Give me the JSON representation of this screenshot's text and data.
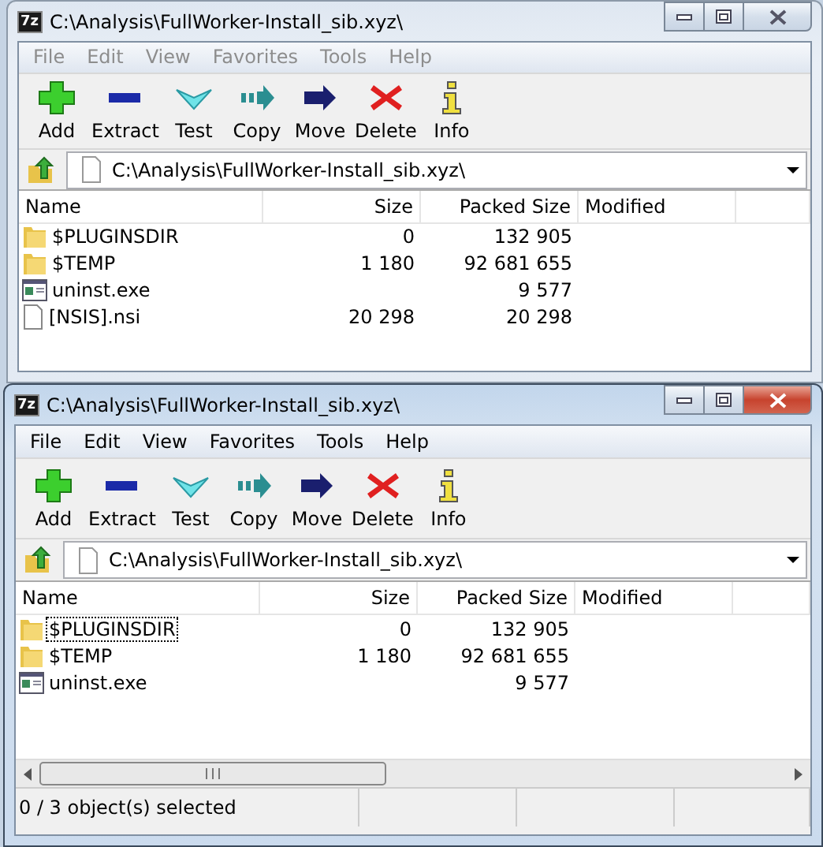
{
  "windows": [
    {
      "icon_label": "7z",
      "title": "C:\\Analysis\\FullWorker-Install_sib.xyz\\",
      "active": false,
      "menu": [
        "File",
        "Edit",
        "View",
        "Favorites",
        "Tools",
        "Help"
      ],
      "toolbar": [
        {
          "kind": "add",
          "label": "Add"
        },
        {
          "kind": "extract",
          "label": "Extract"
        },
        {
          "kind": "test",
          "label": "Test"
        },
        {
          "kind": "copy",
          "label": "Copy"
        },
        {
          "kind": "move",
          "label": "Move"
        },
        {
          "kind": "delete",
          "label": "Delete"
        },
        {
          "kind": "info",
          "label": "Info"
        }
      ],
      "address": "C:\\Analysis\\FullWorker-Install_sib.xyz\\",
      "columns": [
        "Name",
        "Size",
        "Packed Size",
        "Modified"
      ],
      "rows": [
        {
          "kind": "folder",
          "name": "$PLUGINSDIR",
          "size": "0",
          "packed": "132 905",
          "focused": false
        },
        {
          "kind": "folder",
          "name": "$TEMP",
          "size": "1 180",
          "packed": "92 681 655",
          "focused": false
        },
        {
          "kind": "exe",
          "name": "uninst.exe",
          "packed": "9 577",
          "focused": false
        },
        {
          "kind": "file",
          "name": "[NSIS].nsi",
          "size": "20 298",
          "packed": "20 298",
          "focused": false
        }
      ],
      "horizontal_scrollbar": false
    },
    {
      "icon_label": "7z",
      "title": "C:\\Analysis\\FullWorker-Install_sib.xyz\\",
      "active": true,
      "menu": [
        "File",
        "Edit",
        "View",
        "Favorites",
        "Tools",
        "Help"
      ],
      "toolbar": [
        {
          "kind": "add",
          "label": "Add"
        },
        {
          "kind": "extract",
          "label": "Extract"
        },
        {
          "kind": "test",
          "label": "Test"
        },
        {
          "kind": "copy",
          "label": "Copy"
        },
        {
          "kind": "move",
          "label": "Move"
        },
        {
          "kind": "delete",
          "label": "Delete"
        },
        {
          "kind": "info",
          "label": "Info"
        }
      ],
      "address": "C:\\Analysis\\FullWorker-Install_sib.xyz\\",
      "columns": [
        "Name",
        "Size",
        "Packed Size",
        "Modified"
      ],
      "rows": [
        {
          "kind": "folder",
          "name": "$PLUGINSDIR",
          "size": "0",
          "packed": "132 905",
          "focused": true
        },
        {
          "kind": "folder",
          "name": "$TEMP",
          "size": "1 180",
          "packed": "92 681 655",
          "focused": false
        },
        {
          "kind": "exe",
          "name": "uninst.exe",
          "packed": "9 577",
          "focused": false
        }
      ],
      "horizontal_scrollbar": true,
      "status_bar": [
        "0 / 3 object(s) selected"
      ]
    }
  ]
}
